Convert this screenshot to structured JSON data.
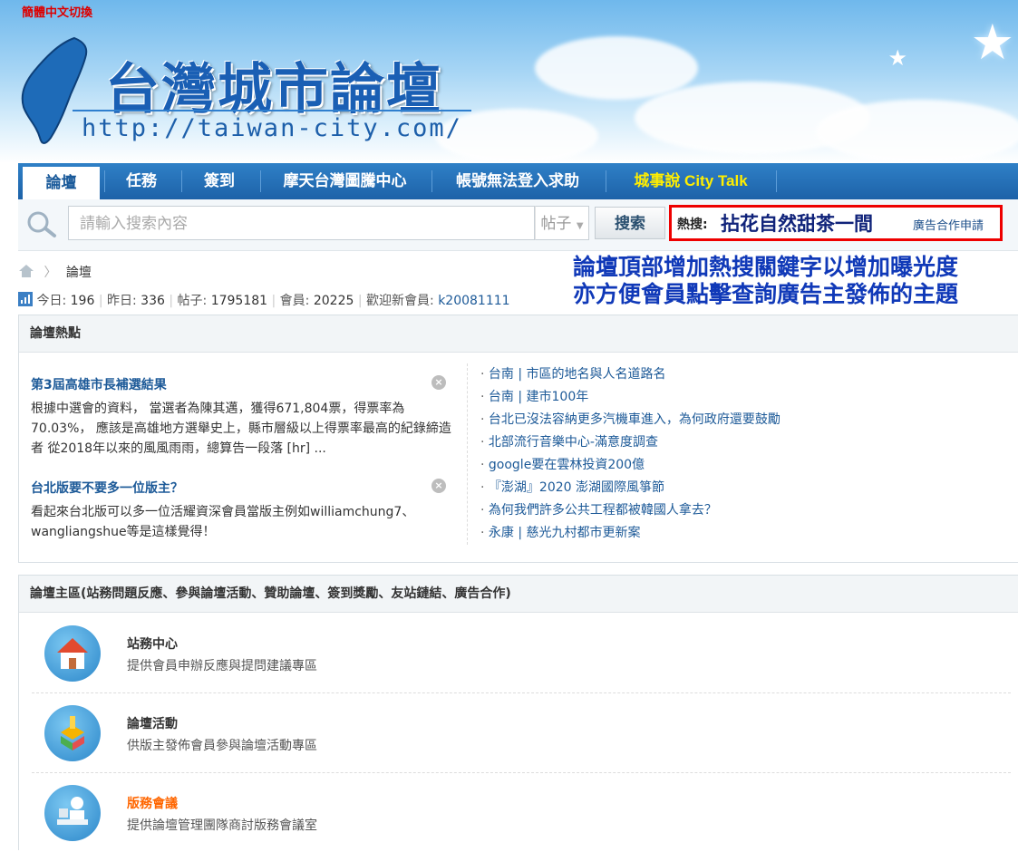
{
  "header": {
    "lang_link": "簡體中文切換",
    "logo_title": "台灣城市論壇",
    "logo_url": "http://taiwan-city.com/"
  },
  "nav": {
    "items": [
      {
        "label": "論壇"
      },
      {
        "label": "任務"
      },
      {
        "label": "簽到"
      },
      {
        "label": "摩天台灣圖騰中心"
      },
      {
        "label": "帳號無法登入求助"
      },
      {
        "label": "城事說 City Talk"
      }
    ]
  },
  "search": {
    "placeholder": "請輸入搜索內容",
    "type": "帖子",
    "button": "搜索",
    "hot_label": "熱搜:",
    "hot_keyword": "拈花自然甜茶一間",
    "ad_link": "廣告合作申請"
  },
  "breadcrumb": {
    "current": "論壇"
  },
  "stats": {
    "today_label": "今日:",
    "today": "196",
    "yesterday_label": "昨日:",
    "yesterday": "336",
    "posts_label": "帖子:",
    "posts": "1795181",
    "members_label": "會員:",
    "members": "20225",
    "welcome_label": "歡迎新會員:",
    "new_member": "k20081111"
  },
  "promo": {
    "line1": "論壇頂部增加熱搜關鍵字以增加曝光度",
    "line2": "亦方便會員點擊查詢廣告主發佈的主題"
  },
  "hot_panel": {
    "title": "論壇熱點",
    "threads": [
      {
        "title": "第3屆高雄市長補選結果",
        "body": "根據中選會的資料， 當選者為陳其邁，獲得671,804票，得票率為70.03%， 應該是高雄地方選舉史上，縣市層級以上得票率最高的紀錄締造者 從2018年以來的風風雨雨，總算告一段落 [hr] ..."
      },
      {
        "title": "台北版要不要多一位版主？",
        "body": "看起來台北版可以多一位活耀資深會員當版主例如williamchung7、wangliangshue等是這樣覺得！"
      }
    ],
    "list": [
      "台南 | 市區的地名與人名道路名",
      "台南 | 建市100年",
      "台北已沒法容納更多汽機車進入，為何政府還要鼓勵",
      "北部流行音樂中心-滿意度調查",
      "google要在雲林投資200億",
      "『澎湖』2020 澎湖國際風箏節",
      "為何我們許多公共工程都被韓國人拿去？",
      "永康 | 慈光九村都市更新案"
    ]
  },
  "main_panel": {
    "title": "論壇主區(站務問題反應、參與論壇活動、贊助論壇、簽到獎勵、友站鏈結、廣告合作)",
    "forums": [
      {
        "name": "站務中心",
        "desc": "提供會員申辦反應與提問建議專區"
      },
      {
        "name": "論壇活動",
        "desc": "供版主發佈會員參與論壇活動專區"
      },
      {
        "name": "版務會議",
        "desc": "提供論壇管理團隊商討版務會議室"
      }
    ]
  },
  "colors": {
    "nav_blue": "#1d62a8",
    "link_blue": "#1d5a98",
    "hot_red": "#e00000",
    "promo_blue": "#1039b8",
    "special_orange": "#ff6600",
    "city_talk_yellow": "#ffee00"
  }
}
